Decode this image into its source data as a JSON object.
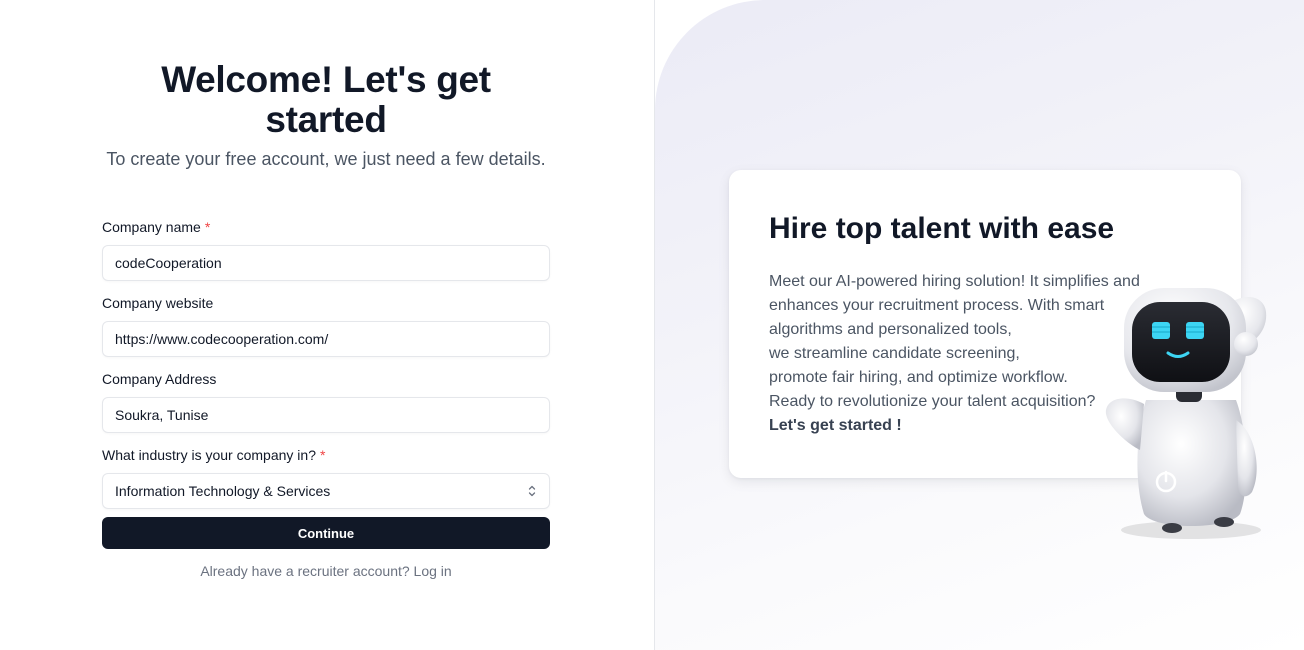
{
  "form": {
    "heading": "Welcome! Let's get started",
    "subheading": "To create your free account, we just need a few details.",
    "fields": [
      {
        "label": "Company name",
        "required": true,
        "value": "codeCooperation"
      },
      {
        "label": "Company website",
        "required": false,
        "value": "https://www.codecooperation.com/"
      },
      {
        "label": "Company Address",
        "required": false,
        "value": "Soukra, Tunise"
      },
      {
        "label": "What industry is your company in?",
        "required": true,
        "value": "Information Technology & Services"
      }
    ],
    "required_mark": "*",
    "continue_label": "Continue",
    "login_prompt": "Already have a recruiter account? Log in"
  },
  "promo": {
    "title": "Hire top talent with ease",
    "body_lines": [
      "Meet our AI-powered hiring solution! It simplifies and",
      "enhances your recruitment process. With smart",
      "algorithms and personalized tools,",
      "we streamline candidate screening,",
      "promote fair hiring, and optimize workflow.",
      "Ready to revolutionize your talent acquisition?"
    ],
    "cta": "Let's get started !"
  },
  "colors": {
    "primary": "#111827",
    "required": "#ef4444",
    "robot_screen": "#3dd5f3"
  },
  "icons": {
    "select_chevron": "chevron-up-down-icon",
    "robot": "robot-mascot-illustration"
  }
}
